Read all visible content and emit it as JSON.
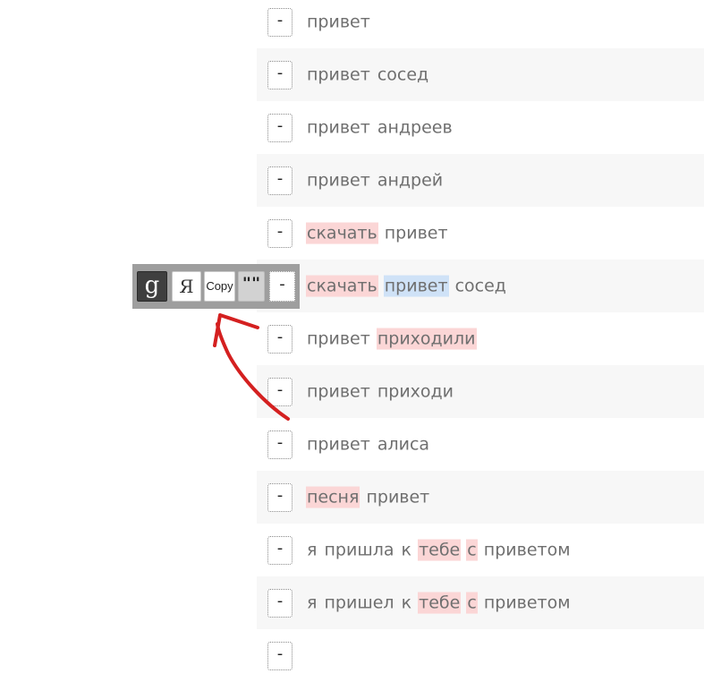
{
  "rows": [
    {
      "words": [
        {
          "text": "привет",
          "hl": ""
        }
      ]
    },
    {
      "words": [
        {
          "text": "привет",
          "hl": ""
        },
        {
          "text": "сосед",
          "hl": ""
        }
      ]
    },
    {
      "words": [
        {
          "text": "привет",
          "hl": ""
        },
        {
          "text": "андреев",
          "hl": ""
        }
      ]
    },
    {
      "words": [
        {
          "text": "привет",
          "hl": ""
        },
        {
          "text": "андрей",
          "hl": ""
        }
      ]
    },
    {
      "words": [
        {
          "text": "скачать",
          "hl": "red"
        },
        {
          "text": "привет",
          "hl": ""
        }
      ]
    },
    {
      "words": [
        {
          "text": "скачать",
          "hl": "red"
        },
        {
          "text": "привет",
          "hl": "blue"
        },
        {
          "text": "сосед",
          "hl": ""
        }
      ]
    },
    {
      "words": [
        {
          "text": "привет",
          "hl": ""
        },
        {
          "text": "приходили",
          "hl": "red"
        }
      ]
    },
    {
      "words": [
        {
          "text": "привет",
          "hl": ""
        },
        {
          "text": "приходи",
          "hl": ""
        }
      ]
    },
    {
      "words": [
        {
          "text": "привет",
          "hl": ""
        },
        {
          "text": "алиса",
          "hl": ""
        }
      ]
    },
    {
      "words": [
        {
          "text": "песня",
          "hl": "red"
        },
        {
          "text": "привет",
          "hl": ""
        }
      ]
    },
    {
      "words": [
        {
          "text": "я",
          "hl": ""
        },
        {
          "text": "пришла",
          "hl": ""
        },
        {
          "text": "к",
          "hl": ""
        },
        {
          "text": "тебе",
          "hl": "red"
        },
        {
          "text": "с",
          "hl": "red"
        },
        {
          "text": "приветом",
          "hl": ""
        }
      ]
    },
    {
      "words": [
        {
          "text": "я",
          "hl": ""
        },
        {
          "text": "пришел",
          "hl": ""
        },
        {
          "text": "к",
          "hl": ""
        },
        {
          "text": "тебе",
          "hl": "red"
        },
        {
          "text": "с",
          "hl": "red"
        },
        {
          "text": "приветом",
          "hl": ""
        }
      ]
    },
    {
      "words": []
    }
  ],
  "minus_label": "-",
  "toolbar": {
    "google_label": "g",
    "google_icon": "google-icon",
    "yandex_label": "Я",
    "yandex_icon": "yandex-icon",
    "copy_label": "Copy",
    "quotes_label": "\"\"",
    "minus_label": "-"
  },
  "colors": {
    "highlight_red": "#fbd6d6",
    "highlight_blue": "#cfe2f7",
    "arrow": "#d42020",
    "toolbar_bg": "#9e9e9e"
  }
}
